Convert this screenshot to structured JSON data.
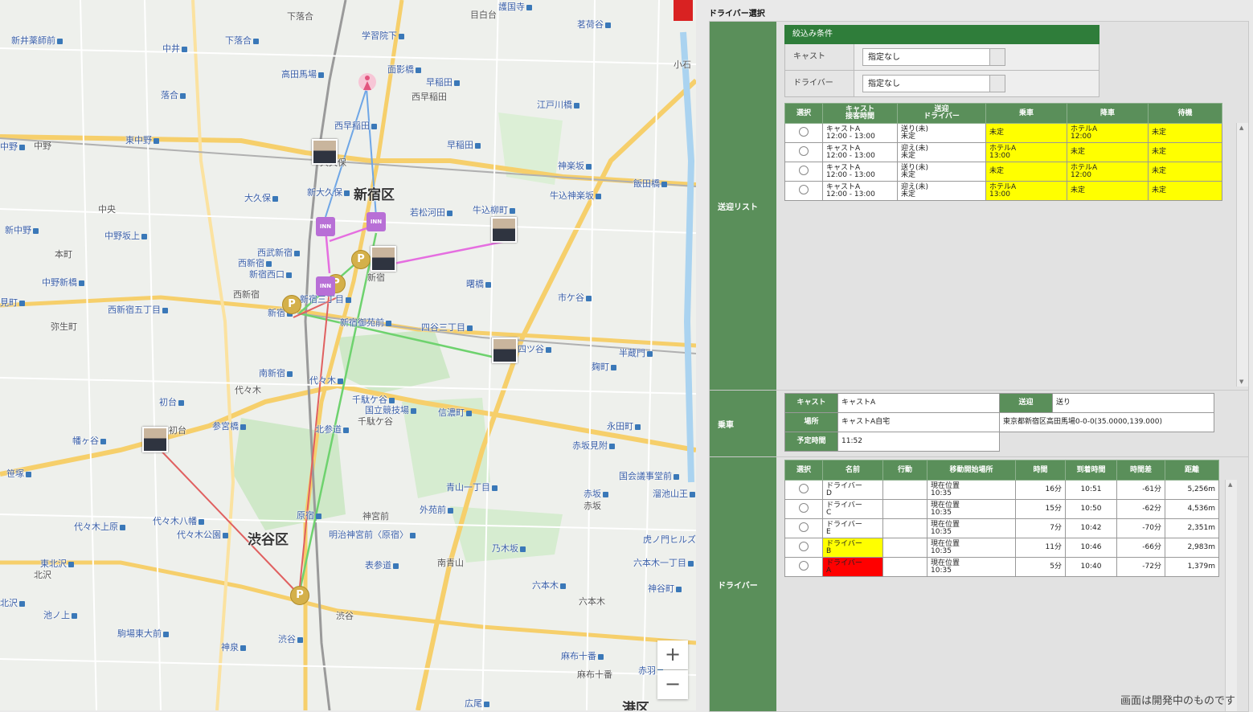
{
  "map": {
    "place_labels": [
      {
        "text": "下落合",
        "cls": ""
      },
      {
        "text": "護国寺",
        "cls": "blue"
      },
      {
        "text": "新井薬師前",
        "cls": "blue"
      },
      {
        "text": "中井",
        "cls": "blue"
      },
      {
        "text": "下落合",
        "cls": "blue"
      },
      {
        "text": "学習院下",
        "cls": "blue"
      },
      {
        "text": "目白台",
        "cls": ""
      },
      {
        "text": "茗荷谷",
        "cls": "blue"
      },
      {
        "text": "高田馬場",
        "cls": "blue"
      },
      {
        "text": "面影橋",
        "cls": "blue"
      },
      {
        "text": "早稲田",
        "cls": "blue"
      },
      {
        "text": "西早稲田",
        "cls": ""
      },
      {
        "text": "落合",
        "cls": "blue"
      },
      {
        "text": "江戸川橋",
        "cls": "blue"
      },
      {
        "text": "中野",
        "cls": ""
      },
      {
        "text": "東中野",
        "cls": "blue"
      },
      {
        "text": "西早稲田",
        "cls": "blue"
      },
      {
        "text": "早稲田",
        "cls": "blue"
      },
      {
        "text": "神楽坂",
        "cls": "blue"
      },
      {
        "text": "大久保",
        "cls": ""
      },
      {
        "text": "飯田橋",
        "cls": "blue"
      },
      {
        "text": "大久保",
        "cls": "blue"
      },
      {
        "text": "新大久保",
        "cls": "blue"
      },
      {
        "text": "新宿区",
        "cls": "big"
      },
      {
        "text": "牛込神楽坂",
        "cls": "blue"
      },
      {
        "text": "中央",
        "cls": ""
      },
      {
        "text": "若松河田",
        "cls": "blue"
      },
      {
        "text": "牛込柳町",
        "cls": "blue"
      },
      {
        "text": "新中野",
        "cls": "blue"
      },
      {
        "text": "中野坂上",
        "cls": "blue"
      },
      {
        "text": "本町",
        "cls": ""
      },
      {
        "text": "西武新宿",
        "cls": "blue"
      },
      {
        "text": "西新宿",
        "cls": "blue"
      },
      {
        "text": "新宿西口",
        "cls": "blue"
      },
      {
        "text": "新宿",
        "cls": ""
      },
      {
        "text": "中野新橋",
        "cls": "blue"
      },
      {
        "text": "曙橋",
        "cls": "blue"
      },
      {
        "text": "西新宿",
        "cls": ""
      },
      {
        "text": "市ケ谷",
        "cls": "blue"
      },
      {
        "text": "新宿三丁目",
        "cls": "blue"
      },
      {
        "text": "西新宿五丁目",
        "cls": "blue"
      },
      {
        "text": "新宿",
        "cls": "blue"
      },
      {
        "text": "弥生町",
        "cls": ""
      },
      {
        "text": "新宿御苑前",
        "cls": "blue"
      },
      {
        "text": "四谷三丁目",
        "cls": "blue"
      },
      {
        "text": "四ツ谷",
        "cls": "blue"
      },
      {
        "text": "半蔵門",
        "cls": "blue"
      },
      {
        "text": "麹町",
        "cls": "blue"
      },
      {
        "text": "南新宿",
        "cls": "blue"
      },
      {
        "text": "代々木",
        "cls": "blue"
      },
      {
        "text": "代々木",
        "cls": ""
      },
      {
        "text": "千駄ケ谷",
        "cls": "blue"
      },
      {
        "text": "初台",
        "cls": "blue"
      },
      {
        "text": "国立競技場",
        "cls": "blue"
      },
      {
        "text": "信濃町",
        "cls": "blue"
      },
      {
        "text": "千駄ケ谷",
        "cls": ""
      },
      {
        "text": "参宮橋",
        "cls": "blue"
      },
      {
        "text": "永田町",
        "cls": "blue"
      },
      {
        "text": "幡ヶ谷",
        "cls": "blue"
      },
      {
        "text": "初台",
        "cls": ""
      },
      {
        "text": "北参道",
        "cls": "blue"
      },
      {
        "text": "赤坂見附",
        "cls": "blue"
      },
      {
        "text": "笹塚",
        "cls": "blue"
      },
      {
        "text": "国会議事堂前",
        "cls": "blue"
      },
      {
        "text": "青山一丁目",
        "cls": "blue"
      },
      {
        "text": "溜池山王",
        "cls": "blue"
      },
      {
        "text": "赤坂",
        "cls": "blue"
      },
      {
        "text": "原宿",
        "cls": "blue"
      },
      {
        "text": "神宮前",
        "cls": ""
      },
      {
        "text": "外苑前",
        "cls": "blue"
      },
      {
        "text": "赤坂",
        "cls": ""
      },
      {
        "text": "代々木八幡",
        "cls": "blue"
      },
      {
        "text": "代々木上原",
        "cls": "blue"
      },
      {
        "text": "代々木公園",
        "cls": "blue"
      },
      {
        "text": "渋谷区",
        "cls": "big"
      },
      {
        "text": "明治神宮前〈原宿〉",
        "cls": "blue"
      },
      {
        "text": "乃木坂",
        "cls": "blue"
      },
      {
        "text": "虎ノ門ヒルズ",
        "cls": "blue"
      },
      {
        "text": "東北沢",
        "cls": "blue"
      },
      {
        "text": "北沢",
        "cls": ""
      },
      {
        "text": "表参道",
        "cls": "blue"
      },
      {
        "text": "南青山",
        "cls": ""
      },
      {
        "text": "六本木一丁目",
        "cls": "blue"
      },
      {
        "text": "六本木",
        "cls": "blue"
      },
      {
        "text": "神谷町",
        "cls": "blue"
      },
      {
        "text": "池ノ上",
        "cls": "blue"
      },
      {
        "text": "六本木",
        "cls": ""
      },
      {
        "text": "渋谷",
        "cls": ""
      },
      {
        "text": "駒場東大前",
        "cls": "blue"
      },
      {
        "text": "渋谷",
        "cls": "blue"
      },
      {
        "text": "神泉",
        "cls": "blue"
      },
      {
        "text": "麻布十番",
        "cls": "blue"
      },
      {
        "text": "麻布十番",
        "cls": ""
      },
      {
        "text": "広尾",
        "cls": "blue"
      },
      {
        "text": "港区",
        "cls": "big"
      },
      {
        "text": "小石",
        "cls": ""
      },
      {
        "text": "赤羽",
        "cls": "blue"
      },
      {
        "text": "見町",
        "cls": "blue"
      },
      {
        "text": "北沢",
        "cls": "blue"
      },
      {
        "text": "中野",
        "cls": "blue"
      }
    ],
    "parking_label": "P",
    "hotel_label": "INN",
    "zoom_in": "+",
    "zoom_out": "−"
  },
  "panel": {
    "title": "ドライバー選択",
    "filter": {
      "header": "絞込み条件",
      "cast_label": "キャスト",
      "cast_value": "指定なし",
      "driver_label": "ドライバー",
      "driver_value": "指定なし"
    },
    "transfer_list": {
      "section_label": "送迎リスト",
      "headers": [
        "選択",
        "キャスト\n接客時間",
        "送迎\nドライバー",
        "乗車",
        "降車",
        "待機"
      ],
      "rows": [
        {
          "cast": "キャストA",
          "time": "12:00 - 13:00",
          "mode": "送り(未)",
          "driver": "未定",
          "pickup": "未定",
          "pickup_time": "",
          "dropoff": "ホテルA",
          "dropoff_time": "12:00",
          "wait": "未定"
        },
        {
          "cast": "キャストA",
          "time": "12:00 - 13:00",
          "mode": "迎え(未)",
          "driver": "未定",
          "pickup": "ホテルA",
          "pickup_time": "13:00",
          "dropoff": "未定",
          "dropoff_time": "",
          "wait": "未定"
        },
        {
          "cast": "キャストA",
          "time": "12:00 - 13:00",
          "mode": "送り(未)",
          "driver": "未定",
          "pickup": "未定",
          "pickup_time": "",
          "dropoff": "ホテルA",
          "dropoff_time": "12:00",
          "wait": "未定"
        },
        {
          "cast": "キャストA",
          "time": "12:00 - 13:00",
          "mode": "迎え(未)",
          "driver": "未定",
          "pickup": "ホテルA",
          "pickup_time": "13:00",
          "dropoff": "未定",
          "dropoff_time": "",
          "wait": "未定"
        }
      ]
    },
    "ride": {
      "section_label": "乗車",
      "cast_label": "キャスト",
      "cast_value": "キャストA",
      "transfer_label": "送迎",
      "transfer_value": "送り",
      "place_label": "場所",
      "place_value": "キャストA自宅",
      "address": "東京都新宿区高田馬場0-0-0(35.0000,139.000)",
      "scheduled_label": "予定時間",
      "scheduled_value": "11:52"
    },
    "drivers": {
      "section_label": "ドライバー",
      "headers": [
        "選択",
        "名前",
        "行動",
        "移動開始場所",
        "時間",
        "到着時間",
        "時間差",
        "距離"
      ],
      "rows": [
        {
          "name": "ドライバー",
          "code": "D",
          "color": "",
          "action": "",
          "start": "現在位置",
          "start_time": "10:35",
          "duration": "16分",
          "arrival": "10:51",
          "diff": "-61分",
          "distance": "5,256m"
        },
        {
          "name": "ドライバー",
          "code": "C",
          "color": "",
          "action": "",
          "start": "現在位置",
          "start_time": "10:35",
          "duration": "15分",
          "arrival": "10:50",
          "diff": "-62分",
          "distance": "4,536m"
        },
        {
          "name": "ドライバー",
          "code": "E",
          "color": "",
          "action": "",
          "start": "現在位置",
          "start_time": "10:35",
          "duration": "7分",
          "arrival": "10:42",
          "diff": "-70分",
          "distance": "2,351m"
        },
        {
          "name": "ドライバー",
          "code": "B",
          "color": "#ffff00",
          "action": "",
          "start": "現在位置",
          "start_time": "10:35",
          "duration": "11分",
          "arrival": "10:46",
          "diff": "-66分",
          "distance": "2,983m"
        },
        {
          "name": "ドライバー",
          "code": "A",
          "color": "#ff0000",
          "action": "",
          "start": "現在位置",
          "start_time": "10:35",
          "duration": "5分",
          "arrival": "10:40",
          "diff": "-72分",
          "distance": "1,379m"
        }
      ]
    },
    "footer_note": "画面は開発中のものです"
  },
  "colors": {
    "accent_green": "#5a8f5a",
    "highlight_yellow": "#ffff00",
    "highlight_red": "#ff0000"
  }
}
